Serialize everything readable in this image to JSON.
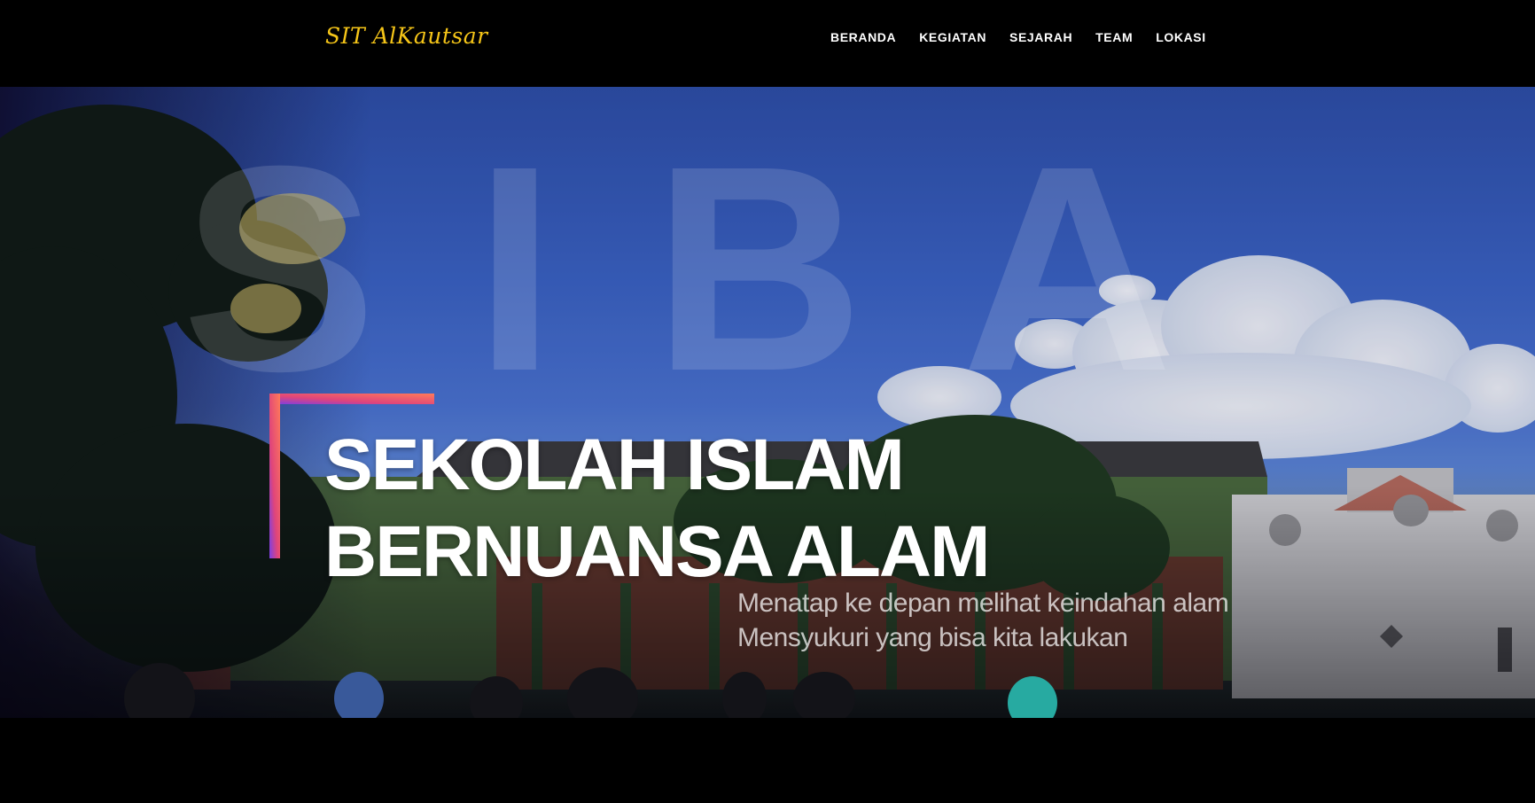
{
  "navbar": {
    "brand": "SIT AlKautsar",
    "links": [
      {
        "label": "BERANDA"
      },
      {
        "label": "KEGIATAN"
      },
      {
        "label": "SEJARAH"
      },
      {
        "label": "TEAM"
      },
      {
        "label": "LOKASI"
      }
    ]
  },
  "hero": {
    "watermark": "SIBA",
    "headline_line1": "SEKOLAH ISLAM",
    "headline_line2": "BERNUANSA ALAM",
    "tagline_line1": "Menatap ke depan melihat keindahan alam",
    "tagline_line2": "Mensyukuri yang bisa kita lakukan"
  },
  "colors": {
    "brand": "#f5c518",
    "accent_start": "#ff7a59",
    "accent_end": "#7b3fe4",
    "background": "#000000"
  }
}
